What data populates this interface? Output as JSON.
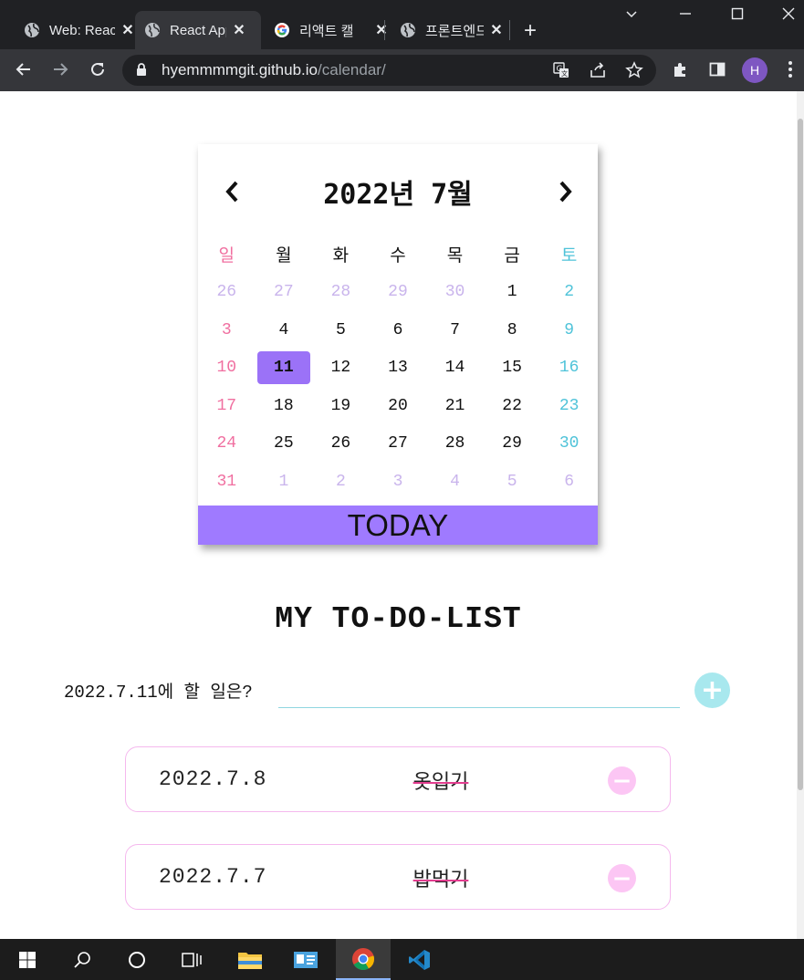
{
  "browser": {
    "tabs": [
      {
        "title": "Web: React",
        "icon": "globe-icon",
        "active": false
      },
      {
        "title": "React App",
        "icon": "globe-icon",
        "active": true
      },
      {
        "title": "리액트 캘",
        "icon": "google-icon",
        "active": false
      },
      {
        "title": "프론트엔드",
        "icon": "globe-icon",
        "active": false
      }
    ],
    "url_host": "hyemmmmgit.github.io",
    "url_path": "/calendar/",
    "profile_initial": "H"
  },
  "calendar": {
    "title": "2022년 7월",
    "prev_label": "‹",
    "next_label": "›",
    "weekdays": [
      "일",
      "월",
      "화",
      "수",
      "목",
      "금",
      "토"
    ],
    "weeks": [
      [
        "26",
        "27",
        "28",
        "29",
        "30",
        "1",
        "2"
      ],
      [
        "3",
        "4",
        "5",
        "6",
        "7",
        "8",
        "9"
      ],
      [
        "10",
        "11",
        "12",
        "13",
        "14",
        "15",
        "16"
      ],
      [
        "17",
        "18",
        "19",
        "20",
        "21",
        "22",
        "23"
      ],
      [
        "24",
        "25",
        "26",
        "27",
        "28",
        "29",
        "30"
      ],
      [
        "31",
        "1",
        "2",
        "3",
        "4",
        "5",
        "6"
      ]
    ],
    "selected_day": "11",
    "today_label": "TODAY",
    "colors": {
      "sunday": "#f06fa0",
      "saturday": "#4fc3d9",
      "other_month": "#c9b4ec",
      "selected": "#9b72f7",
      "today_bar": "#9f7aff"
    }
  },
  "todo": {
    "title": "MY TO-DO-LIST",
    "prompt": "2022.7.11에 할 일은?",
    "input_value": "",
    "add_label": "+",
    "items": [
      {
        "date": "2022.7.8",
        "text": "옷입기",
        "done": true,
        "delete_label": "−"
      },
      {
        "date": "2022.7.7",
        "text": "밥먹기",
        "done": true,
        "delete_label": "−"
      }
    ]
  },
  "taskbar": {
    "items": [
      "windows-start-icon",
      "search-icon",
      "cortana-icon",
      "task-view-icon",
      "file-explorer-icon",
      "control-panel-icon",
      "chrome-icon",
      "vscode-icon"
    ]
  }
}
